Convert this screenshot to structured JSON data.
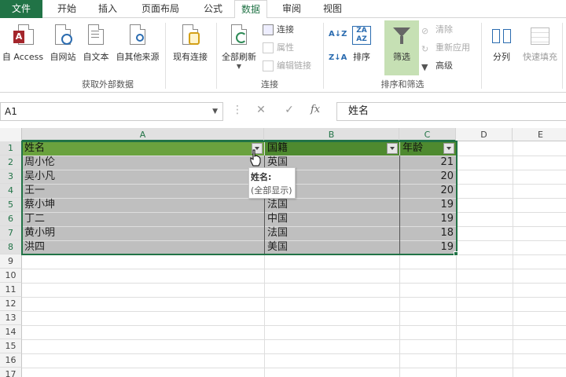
{
  "tabs": [
    {
      "label": "文件"
    },
    {
      "label": "开始"
    },
    {
      "label": "插入"
    },
    {
      "label": "页面布局"
    },
    {
      "label": "公式"
    },
    {
      "label": "数据"
    },
    {
      "label": "审阅"
    },
    {
      "label": "视图"
    }
  ],
  "ribbon": {
    "groups": {
      "external": "获取外部数据",
      "connections": "连接",
      "sortfilter": "排序和筛选"
    },
    "buttons": {
      "access": "自 Access",
      "web": "自网站",
      "text": "自文本",
      "other": "自其他来源",
      "existing": "现有连接",
      "refresh_all": "全部刷新",
      "connections": "连接",
      "properties": "属性",
      "edit_links": "编辑链接",
      "sort": "排序",
      "filter": "筛选",
      "clear": "清除",
      "reapply": "重新应用",
      "advanced": "高级",
      "split": "分列",
      "flash_fill": "快速填充"
    },
    "icons": {
      "access": "access-db-icon",
      "web": "web-globe-icon",
      "text": "text-file-icon",
      "other": "other-sources-icon",
      "existing": "existing-connections-icon",
      "refresh": "refresh-icon",
      "filter": "funnel-icon",
      "sort_az": "sort-az-icon",
      "sort_za": "sort-za-icon"
    }
  },
  "formula_bar": {
    "name_box": "A1",
    "fx": "fx",
    "value": "姓名"
  },
  "grid": {
    "columns": [
      "A",
      "B",
      "C",
      "D",
      "E"
    ],
    "rows": [
      "1",
      "2",
      "3",
      "4",
      "5",
      "6",
      "7",
      "8",
      "9",
      "10",
      "11",
      "12",
      "13",
      "14",
      "15",
      "16",
      "17"
    ],
    "headers": [
      "姓名",
      "国籍",
      "年龄"
    ],
    "data": [
      [
        "周小伦",
        "英国",
        "21"
      ],
      [
        "吴小凡",
        "",
        "20"
      ],
      [
        "王一",
        "",
        "20"
      ],
      [
        "蔡小坤",
        "法国",
        "19"
      ],
      [
        "丁二",
        "中国",
        "19"
      ],
      [
        "黄小明",
        "法国",
        "18"
      ],
      [
        "洪四",
        "美国",
        "19"
      ]
    ]
  },
  "tooltip": {
    "title": "姓名:",
    "body": "(全部显示)"
  },
  "colors": {
    "excel_green": "#217346",
    "header_green": "#6aa23e",
    "header_dark_green": "#4e8a2f",
    "band_gray": "#bfbfbf",
    "filter_active": "#c6e0b4"
  }
}
